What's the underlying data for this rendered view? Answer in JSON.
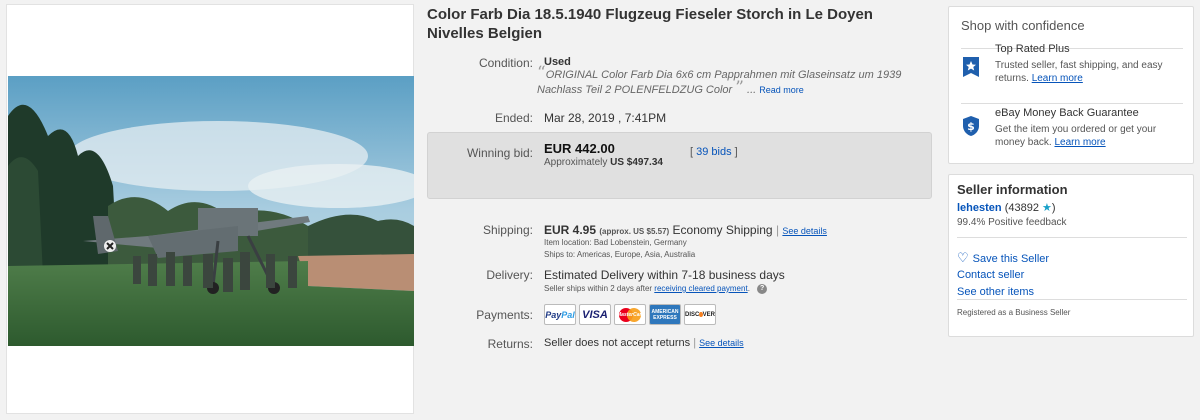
{
  "listing": {
    "title": "Color Farb Dia 18.5.1940 Flugzeug Fieseler Storch in Le Doyen Nivelles Belgien"
  },
  "condition": {
    "label": "Condition:",
    "value": "Used",
    "open_quote": "“",
    "description": "ORIGINAL Color Farb Dia 6x6 cm Papprahmen mit Glaseinsatz um 1939 Nachlass Teil 2 POLENFELDZUG Color",
    "close_quote": "”",
    "ellipsis": "...",
    "read_more": "Read more"
  },
  "ended": {
    "label": "Ended:",
    "value": "Mar 28, 2019 , 7:41PM"
  },
  "bid": {
    "label": "Winning bid:",
    "amount": "EUR 442.00",
    "approx_prefix": "Approximately",
    "approx_value": "US $497.34",
    "open_bracket": "[",
    "bids_link": "39 bids",
    "close_bracket": "]"
  },
  "shipping": {
    "label": "Shipping:",
    "amount": "EUR 4.95",
    "approx": "(approx. US $5.57)",
    "method": "Economy Shipping",
    "separator": "|",
    "see_details": "See details",
    "location_label": "Item location:",
    "location_value": "Bad Lobenstein, Germany",
    "ships_to_label": "Ships to:",
    "ships_to_value": "Americas, Europe, Asia, Australia"
  },
  "delivery": {
    "label": "Delivery:",
    "value": "Estimated Delivery within 7-18 business days",
    "note_prefix": "Seller ships within 2 days after",
    "note_link": "receiving cleared payment",
    "note_suffix": ".",
    "help_icon": "?"
  },
  "payments": {
    "label": "Payments:",
    "methods": {
      "paypal_a": "Pay",
      "paypal_b": "Pal",
      "visa": "VISA",
      "mastercard": "MasterCard",
      "amex_a": "AMERICAN",
      "amex_b": "EXPRESS",
      "discover": "DISC",
      "discover_b": "VER"
    }
  },
  "returns": {
    "label": "Returns:",
    "value": "Seller does not accept returns",
    "separator": "|",
    "see_details": "See details"
  },
  "confidence": {
    "title": "Shop with confidence",
    "top_rated_title": "Top Rated Plus",
    "top_rated_text": "Trusted seller, fast shipping, and easy returns.",
    "top_rated_link": "Learn more",
    "guarantee_title": "eBay Money Back Guarantee",
    "guarantee_text": "Get the item you ordered or get your money back.",
    "guarantee_link": "Learn more"
  },
  "seller": {
    "title": "Seller information",
    "name": "lehesten",
    "score": "(43892",
    "star": "★",
    "score_close": ")",
    "feedback": "99.4% Positive feedback",
    "save_heart": "♡",
    "save": "Save this Seller",
    "contact": "Contact seller",
    "other_items": "See other items",
    "registered": "Registered as a Business Seller"
  },
  "colors": {
    "link": "#0654ba",
    "bid_box": "#e0e0e0",
    "top_rated_badge": "#1f5fad",
    "star": "#18a0c8"
  }
}
